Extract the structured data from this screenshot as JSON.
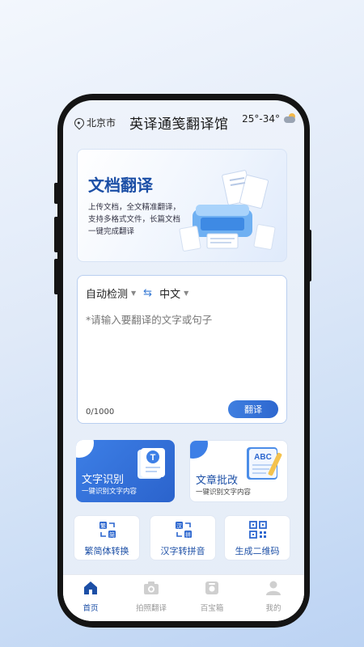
{
  "header": {
    "location": "北京市",
    "app_title": "英译通笺翻译馆",
    "temperature": "25°-34°"
  },
  "banner": {
    "title": "文档翻译",
    "desc_lines": [
      "上传文档，全文精准翻译，",
      "支持多格式文件，长篇文档",
      "一键完成翻译"
    ]
  },
  "translator": {
    "source_lang": "自动检测",
    "target_lang": "中文",
    "placeholder": "*请输入要翻译的文字或句子",
    "counter": "0/1000",
    "button": "翻译"
  },
  "feature_cards": [
    {
      "title": "文字识别",
      "subtitle": "一键识别文字内容",
      "icon": "ocr-t-icon"
    },
    {
      "title": "文章批改",
      "subtitle": "一键识别文字内容",
      "icon": "abc-essay-icon"
    }
  ],
  "tools": [
    {
      "label": "繁简体转换",
      "glyph_a": "繁",
      "glyph_b": "简"
    },
    {
      "label": "汉字转拼音",
      "glyph_a": "汉",
      "glyph_b": "拼"
    },
    {
      "label": "生成二维码"
    }
  ],
  "tabs": [
    {
      "label": "首页",
      "active": true
    },
    {
      "label": "拍照翻译",
      "active": false
    },
    {
      "label": "百宝箱",
      "active": false
    },
    {
      "label": "我的",
      "active": false
    }
  ],
  "colors": {
    "primary": "#2d67cf",
    "title_blue": "#1c4fa6"
  }
}
